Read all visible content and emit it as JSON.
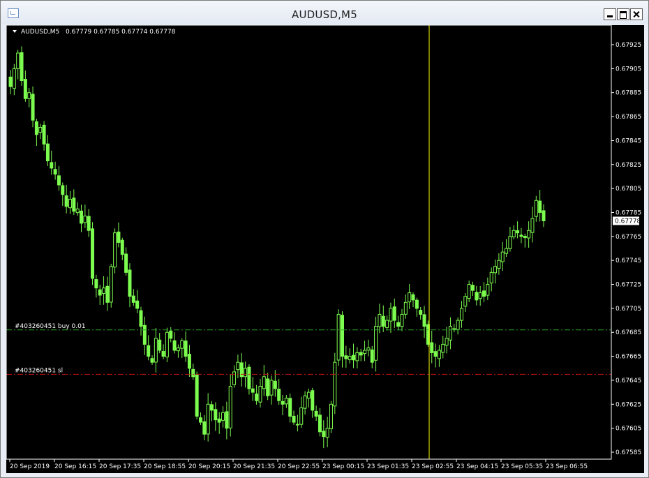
{
  "window": {
    "title": "AUDUSD,M5"
  },
  "header": {
    "symbol_text": "AUDUSD,M5",
    "ohlc_text": "0.67779 0.67785 0.67774 0.67778"
  },
  "orders": [
    {
      "label": "#403260451 buy 0.01",
      "price": 0.67687,
      "color": "#2aa12a"
    },
    {
      "label": "#403260451 sl",
      "price": 0.6765,
      "color": "#c81414"
    }
  ],
  "colors": {
    "background": "#000000",
    "candle": "#7cfc4e",
    "axis": "#ffffff",
    "crosshair": "#ffff00"
  },
  "chart_data": {
    "type": "candlestick",
    "symbol": "AUDUSD",
    "timeframe": "M5",
    "ylim": [
      0.6758,
      0.67935
    ],
    "y_ticks": [
      "0.67925",
      "0.67905",
      "0.67885",
      "0.67865",
      "0.67845",
      "0.67825",
      "0.67805",
      "0.67785",
      "0.67765",
      "0.67745",
      "0.67725",
      "0.67705",
      "0.67685",
      "0.67665",
      "0.67645",
      "0.67625",
      "0.67605",
      "0.67585"
    ],
    "current_price": "0.67778",
    "x_ticks": [
      "20 Sep 2019",
      "20 Sep 16:15",
      "20 Sep 17:35",
      "20 Sep 18:55",
      "20 Sep 20:15",
      "20 Sep 21:35",
      "20 Sep 22:55",
      "23 Sep 00:15",
      "23 Sep 01:35",
      "23 Sep 02:55",
      "23 Sep 04:15",
      "23 Sep 05:35",
      "23 Sep 06:55"
    ],
    "vertical_line_at": "23 Sep 02:55",
    "close": [
      0.6789,
      0.67905,
      0.67918,
      0.67895,
      0.6788,
      0.67885,
      0.67862,
      0.6785,
      0.67856,
      0.67842,
      0.67828,
      0.67822,
      0.67817,
      0.67808,
      0.678,
      0.6779,
      0.67796,
      0.67786,
      0.67788,
      0.67776,
      0.67782,
      0.6777,
      0.6773,
      0.67722,
      0.67716,
      0.67722,
      0.6771,
      0.6774,
      0.67768,
      0.6776,
      0.6775,
      0.67735,
      0.67715,
      0.6771,
      0.67705,
      0.6769,
      0.67675,
      0.67665,
      0.6766,
      0.6768,
      0.6767,
      0.67665,
      0.67685,
      0.6768,
      0.6767,
      0.67672,
      0.67678,
      0.67665,
      0.67655,
      0.67648,
      0.67615,
      0.6761,
      0.676,
      0.67625,
      0.6762,
      0.67612,
      0.6761,
      0.67618,
      0.67605,
      0.6764,
      0.67652,
      0.6766,
      0.67648,
      0.67655,
      0.67638,
      0.67635,
      0.67628,
      0.6764,
      0.67648,
      0.67632,
      0.67645,
      0.67638,
      0.67628,
      0.67625,
      0.6763,
      0.67615,
      0.6761,
      0.67608,
      0.67622,
      0.67632,
      0.67635,
      0.6762,
      0.67615,
      0.67602,
      0.67598,
      0.67605,
      0.67625,
      0.6766,
      0.677,
      0.67665,
      0.67663,
      0.67665,
      0.67662,
      0.67668,
      0.67666,
      0.6767,
      0.67672,
      0.6766,
      0.6769,
      0.677,
      0.6769,
      0.67695,
      0.67705,
      0.67695,
      0.6769,
      0.677,
      0.6771,
      0.67718,
      0.67712,
      0.67705,
      0.677,
      0.6769,
      0.67675,
      0.67668,
      0.67665,
      0.6767,
      0.67675,
      0.6768,
      0.6769,
      0.67688,
      0.67695,
      0.67705,
      0.67715,
      0.67725,
      0.6772,
      0.67712,
      0.67718,
      0.67715,
      0.67725,
      0.67735,
      0.6774,
      0.67745,
      0.67752,
      0.67755,
      0.67765,
      0.6777,
      0.67768,
      0.67765,
      0.67764,
      0.6777,
      0.6778,
      0.67795,
      0.67785,
      0.67778
    ]
  }
}
